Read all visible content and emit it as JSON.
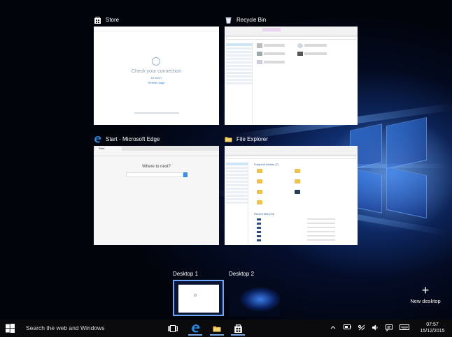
{
  "task_view": {
    "windows": [
      {
        "title": "Store",
        "icon": "store-icon"
      },
      {
        "title": "Recycle Bin",
        "icon": "recycle-bin-icon"
      },
      {
        "title": "Start - Microsoft Edge",
        "icon": "edge-icon"
      },
      {
        "title": "File Explorer",
        "icon": "folder-icon"
      }
    ],
    "store": {
      "heading": "Check your connection",
      "sub": "All fixed?",
      "link": "Refresh page"
    },
    "edge": {
      "tab": "Start",
      "heading": "Where to next?"
    },
    "explorer": {
      "section_frequent": "Frequent folders (7)",
      "section_recent": "Recent files (20)"
    }
  },
  "desktops": [
    {
      "label": "Desktop 1",
      "active": true
    },
    {
      "label": "Desktop 2",
      "active": false
    }
  ],
  "new_desktop": {
    "label": "New desktop",
    "icon": "plus-icon"
  },
  "taskbar": {
    "search_placeholder": "Search the web and Windows",
    "apps": [
      {
        "name": "task-view",
        "icon": "task-view-icon"
      },
      {
        "name": "edge",
        "icon": "edge-icon",
        "active": true
      },
      {
        "name": "file-explorer",
        "icon": "folder-icon",
        "active": true
      },
      {
        "name": "store",
        "icon": "store-icon",
        "active": true
      }
    ],
    "tray": [
      "chevron-up-icon",
      "battery-icon",
      "network-icon",
      "volume-icon",
      "action-center-icon",
      "keyboard-icon"
    ],
    "time": "07:57",
    "date": "15/12/2015"
  },
  "colors": {
    "accent": "#1e90ff",
    "taskbar": "#0b0b0d",
    "selected_border": "#6aa7ff"
  }
}
